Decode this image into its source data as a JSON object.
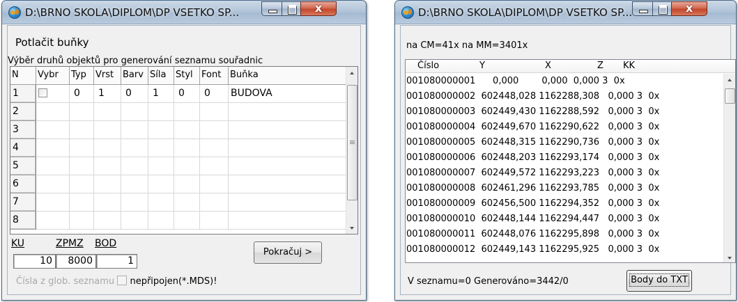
{
  "left_window": {
    "title": "D:\\BRNO SKOLA\\DIPLOM\\DP VSETKO SP...",
    "heading": "Potlačit buňky",
    "description": "Výběr druhů objektů pro generování seznamu souřadnic",
    "grid": {
      "columns": [
        "N",
        "Vybr",
        "Typ",
        "Vrst",
        "Barv",
        "Síla",
        "Styl",
        "Font",
        "Buňka"
      ],
      "rows": [
        {
          "n": "1",
          "typ": "0",
          "vrst": "1",
          "barv": "0",
          "sila": "1",
          "styl": "0",
          "font": "0",
          "bunka": "BUDOVA"
        },
        {
          "n": "2"
        },
        {
          "n": "3"
        },
        {
          "n": "4"
        },
        {
          "n": "5"
        },
        {
          "n": "6"
        },
        {
          "n": "7"
        },
        {
          "n": "8"
        }
      ]
    },
    "fields": {
      "ku_label": "KU",
      "ku_value": "10",
      "zpmz_label": "ZPMZ",
      "zpmz_value": "8000",
      "bod_label": "BOD",
      "bod_value": "1"
    },
    "continue_button": "Pokračuj >",
    "global_list_label": "Čísla z glob. seznamu",
    "unattached_label": "nepřipojen(*.MDS)!"
  },
  "right_window": {
    "title": "D:\\BRNO SKOLA\\DIPLOM\\DP VSETKO SP...",
    "counts_text": "na CM=41x  na MM=3401x",
    "columns": [
      "Číslo",
      "Y",
      "X",
      "Z",
      "KK"
    ],
    "rows": [
      "001080000001      0,000        0,000  0,000 3  0x",
      "001080000002  602448,028 1162288,308   0,000 3  0x",
      "001080000003  602449,430 1162288,592   0,000 3  0x",
      "001080000004  602449,670 1162290,622   0,000 3  0x",
      "001080000005  602448,315 1162290,736   0,000 3  0x",
      "001080000006  602448,203 1162293,174   0,000 3  0x",
      "001080000007  602449,572 1162293,223   0,000 3  0x",
      "001080000008  602461,296 1162293,785   0,000 3  0x",
      "001080000009  602456,500 1162294,352   0,000 3  0x",
      "001080000010  602448,144 1162294,447   0,000 3  0x",
      "001080000011  602448,076 1162295,898   0,000 3  0x",
      "001080000012  602449,143 1162295,925   0,000 3  0x"
    ],
    "status_text": "V seznamu=0  Generováno=3442/0",
    "export_button": "Body do TXT"
  }
}
